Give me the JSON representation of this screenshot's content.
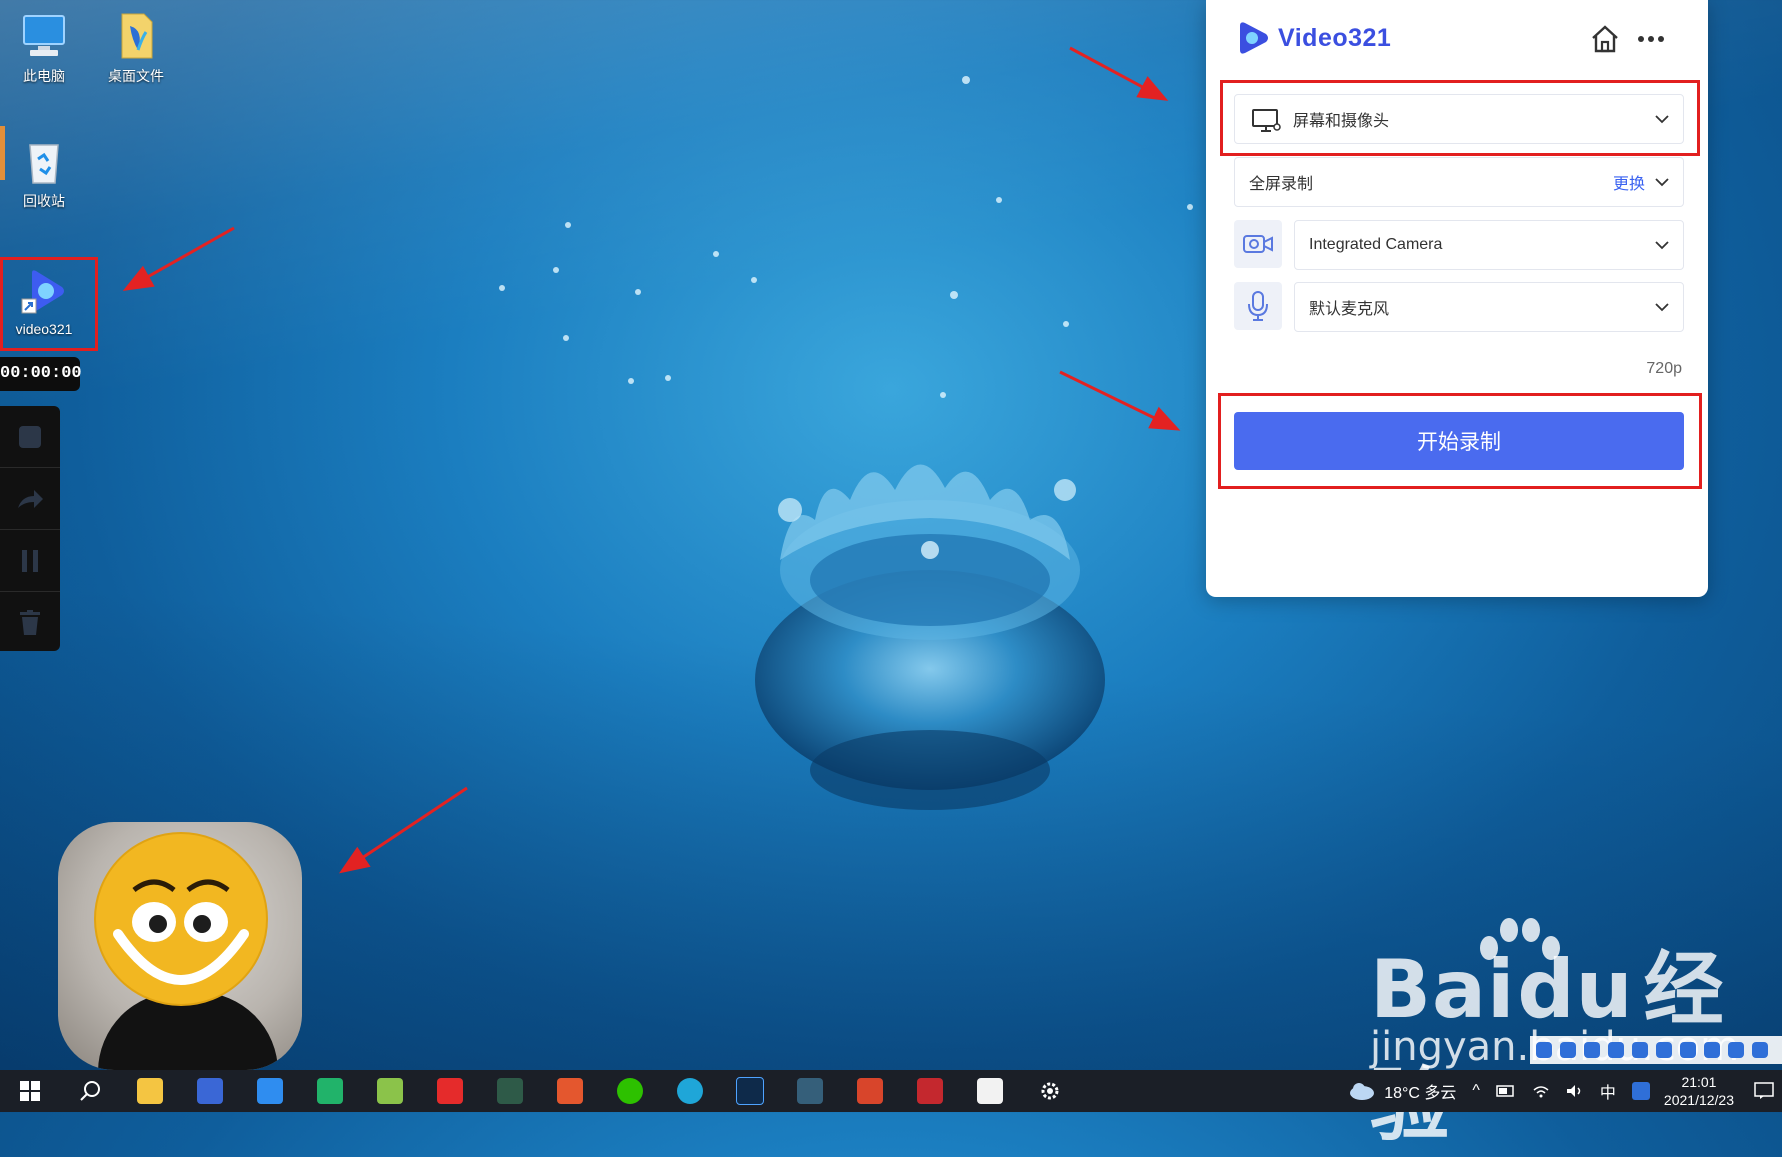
{
  "desktop": {
    "icons": [
      {
        "label": "此电脑",
        "icon": "computer-icon"
      },
      {
        "label": "桌面文件",
        "icon": "folder-icon"
      },
      {
        "label": "回收站",
        "icon": "recycle-bin-icon"
      },
      {
        "label": "video321",
        "icon": "video321-app-icon"
      }
    ]
  },
  "recorder": {
    "timer": "00:00:00",
    "buttons": [
      "stop-icon",
      "share-icon",
      "pause-icon",
      "trash-icon"
    ]
  },
  "app": {
    "brand": "Video321",
    "source_select": "屏幕和摄像头",
    "capture_area": {
      "label": "全屏录制",
      "change": "更换"
    },
    "camera_select": "Integrated Camera",
    "mic_select": "默认麦克风",
    "quality": "720p",
    "start_button": "开始录制",
    "accent": "#4a6bef"
  },
  "watermark": {
    "big_latin": "Bai",
    "big_du": "du",
    "big_cn": "经验",
    "small": "jingyan.baidu.com"
  },
  "taskbar": {
    "weather": "18°C 多云",
    "ime": "中",
    "time": "21:01",
    "date": "2021/12/23"
  }
}
